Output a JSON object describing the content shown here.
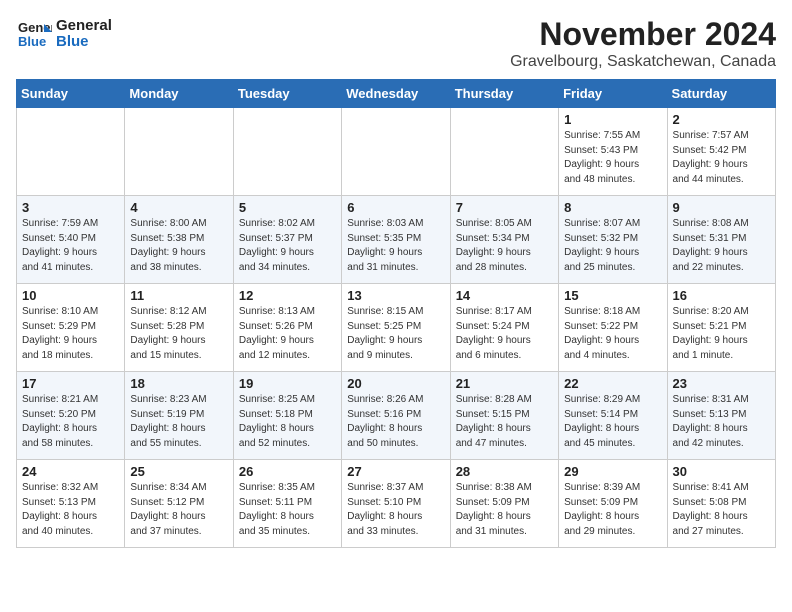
{
  "logo": {
    "line1": "General",
    "line2": "Blue"
  },
  "title": "November 2024",
  "subtitle": "Gravelbourg, Saskatchewan, Canada",
  "headers": [
    "Sunday",
    "Monday",
    "Tuesday",
    "Wednesday",
    "Thursday",
    "Friday",
    "Saturday"
  ],
  "weeks": [
    [
      {
        "day": "",
        "info": ""
      },
      {
        "day": "",
        "info": ""
      },
      {
        "day": "",
        "info": ""
      },
      {
        "day": "",
        "info": ""
      },
      {
        "day": "",
        "info": ""
      },
      {
        "day": "1",
        "info": "Sunrise: 7:55 AM\nSunset: 5:43 PM\nDaylight: 9 hours\nand 48 minutes."
      },
      {
        "day": "2",
        "info": "Sunrise: 7:57 AM\nSunset: 5:42 PM\nDaylight: 9 hours\nand 44 minutes."
      }
    ],
    [
      {
        "day": "3",
        "info": "Sunrise: 7:59 AM\nSunset: 5:40 PM\nDaylight: 9 hours\nand 41 minutes."
      },
      {
        "day": "4",
        "info": "Sunrise: 8:00 AM\nSunset: 5:38 PM\nDaylight: 9 hours\nand 38 minutes."
      },
      {
        "day": "5",
        "info": "Sunrise: 8:02 AM\nSunset: 5:37 PM\nDaylight: 9 hours\nand 34 minutes."
      },
      {
        "day": "6",
        "info": "Sunrise: 8:03 AM\nSunset: 5:35 PM\nDaylight: 9 hours\nand 31 minutes."
      },
      {
        "day": "7",
        "info": "Sunrise: 8:05 AM\nSunset: 5:34 PM\nDaylight: 9 hours\nand 28 minutes."
      },
      {
        "day": "8",
        "info": "Sunrise: 8:07 AM\nSunset: 5:32 PM\nDaylight: 9 hours\nand 25 minutes."
      },
      {
        "day": "9",
        "info": "Sunrise: 8:08 AM\nSunset: 5:31 PM\nDaylight: 9 hours\nand 22 minutes."
      }
    ],
    [
      {
        "day": "10",
        "info": "Sunrise: 8:10 AM\nSunset: 5:29 PM\nDaylight: 9 hours\nand 18 minutes."
      },
      {
        "day": "11",
        "info": "Sunrise: 8:12 AM\nSunset: 5:28 PM\nDaylight: 9 hours\nand 15 minutes."
      },
      {
        "day": "12",
        "info": "Sunrise: 8:13 AM\nSunset: 5:26 PM\nDaylight: 9 hours\nand 12 minutes."
      },
      {
        "day": "13",
        "info": "Sunrise: 8:15 AM\nSunset: 5:25 PM\nDaylight: 9 hours\nand 9 minutes."
      },
      {
        "day": "14",
        "info": "Sunrise: 8:17 AM\nSunset: 5:24 PM\nDaylight: 9 hours\nand 6 minutes."
      },
      {
        "day": "15",
        "info": "Sunrise: 8:18 AM\nSunset: 5:22 PM\nDaylight: 9 hours\nand 4 minutes."
      },
      {
        "day": "16",
        "info": "Sunrise: 8:20 AM\nSunset: 5:21 PM\nDaylight: 9 hours\nand 1 minute."
      }
    ],
    [
      {
        "day": "17",
        "info": "Sunrise: 8:21 AM\nSunset: 5:20 PM\nDaylight: 8 hours\nand 58 minutes."
      },
      {
        "day": "18",
        "info": "Sunrise: 8:23 AM\nSunset: 5:19 PM\nDaylight: 8 hours\nand 55 minutes."
      },
      {
        "day": "19",
        "info": "Sunrise: 8:25 AM\nSunset: 5:18 PM\nDaylight: 8 hours\nand 52 minutes."
      },
      {
        "day": "20",
        "info": "Sunrise: 8:26 AM\nSunset: 5:16 PM\nDaylight: 8 hours\nand 50 minutes."
      },
      {
        "day": "21",
        "info": "Sunrise: 8:28 AM\nSunset: 5:15 PM\nDaylight: 8 hours\nand 47 minutes."
      },
      {
        "day": "22",
        "info": "Sunrise: 8:29 AM\nSunset: 5:14 PM\nDaylight: 8 hours\nand 45 minutes."
      },
      {
        "day": "23",
        "info": "Sunrise: 8:31 AM\nSunset: 5:13 PM\nDaylight: 8 hours\nand 42 minutes."
      }
    ],
    [
      {
        "day": "24",
        "info": "Sunrise: 8:32 AM\nSunset: 5:13 PM\nDaylight: 8 hours\nand 40 minutes."
      },
      {
        "day": "25",
        "info": "Sunrise: 8:34 AM\nSunset: 5:12 PM\nDaylight: 8 hours\nand 37 minutes."
      },
      {
        "day": "26",
        "info": "Sunrise: 8:35 AM\nSunset: 5:11 PM\nDaylight: 8 hours\nand 35 minutes."
      },
      {
        "day": "27",
        "info": "Sunrise: 8:37 AM\nSunset: 5:10 PM\nDaylight: 8 hours\nand 33 minutes."
      },
      {
        "day": "28",
        "info": "Sunrise: 8:38 AM\nSunset: 5:09 PM\nDaylight: 8 hours\nand 31 minutes."
      },
      {
        "day": "29",
        "info": "Sunrise: 8:39 AM\nSunset: 5:09 PM\nDaylight: 8 hours\nand 29 minutes."
      },
      {
        "day": "30",
        "info": "Sunrise: 8:41 AM\nSunset: 5:08 PM\nDaylight: 8 hours\nand 27 minutes."
      }
    ]
  ]
}
